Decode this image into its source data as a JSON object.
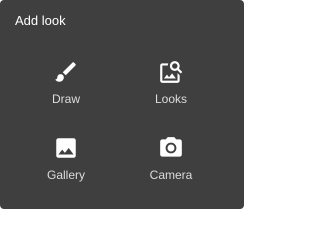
{
  "dialog": {
    "title": "Add look",
    "background": "#3f3f3f",
    "options": [
      {
        "label": "Draw",
        "icon": "brush-icon"
      },
      {
        "label": "Looks",
        "icon": "image-search-icon"
      },
      {
        "label": "Gallery",
        "icon": "image-icon"
      },
      {
        "label": "Camera",
        "icon": "camera-icon"
      }
    ]
  }
}
